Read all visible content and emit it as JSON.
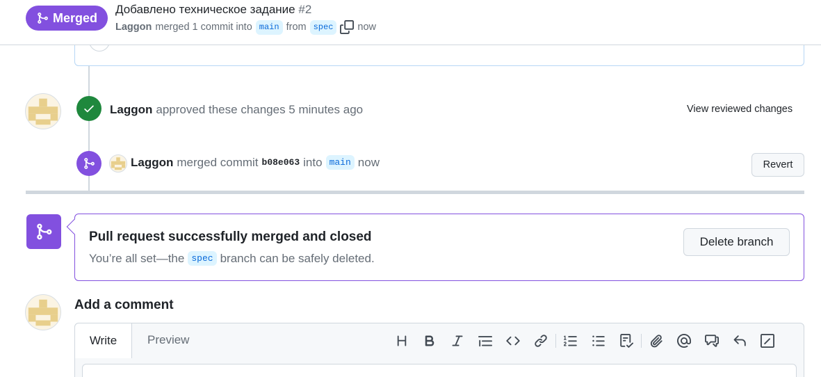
{
  "header": {
    "state": "Merged",
    "title": "Добавлено техническое задание",
    "number": "#2",
    "author": "Laggon",
    "merged_text": "merged 1 commit into",
    "base_branch": "main",
    "from_text": "from",
    "head_branch": "spec",
    "time": "now"
  },
  "timeline": {
    "approved": {
      "author": "Laggon",
      "text": "approved these changes 5 minutes ago",
      "link": "View reviewed changes"
    },
    "merged": {
      "author": "Laggon",
      "text": "merged commit",
      "sha": "b08e063",
      "into": "into",
      "branch": "main",
      "time": "now",
      "revert": "Revert"
    }
  },
  "merge_box": {
    "title": "Pull request successfully merged and closed",
    "desc_before": "You’re all set—the",
    "branch": "spec",
    "desc_after": "branch can be safely deleted.",
    "delete_button": "Delete branch"
  },
  "comment": {
    "heading": "Add a comment",
    "tab_write": "Write",
    "tab_preview": "Preview",
    "toolbar": [
      "heading-icon",
      "bold-icon",
      "italic-icon",
      "quote-icon",
      "code-icon",
      "link-icon",
      "ordered-list-icon",
      "unordered-list-icon",
      "task-list-icon",
      "attach-icon",
      "mention-icon",
      "cross-reference-icon",
      "reply-icon",
      "slash-commands-icon"
    ]
  },
  "colors": {
    "merged": "#8250df",
    "approved": "#1f883d",
    "branch_bg": "#ddf4ff",
    "branch_fg": "#0969da"
  }
}
